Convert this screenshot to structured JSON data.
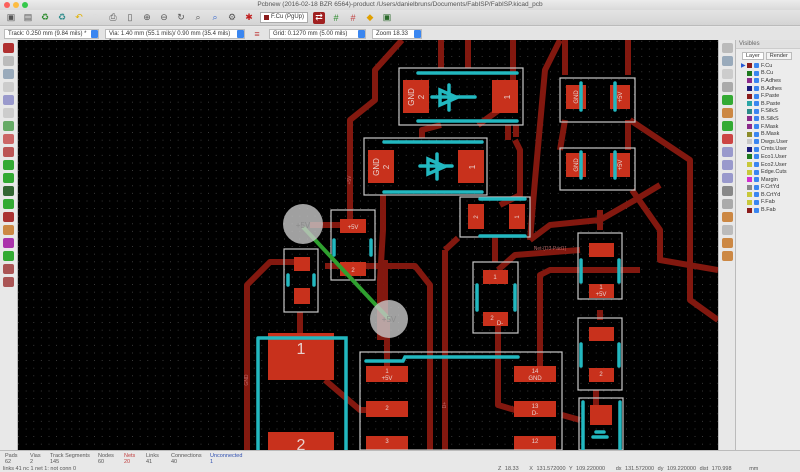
{
  "window": {
    "title": "Pcbnew (2016-02-18 BZR 6564)-product /Users/danielbruns/Documents/FabISP/FabISP.kicad_pcb"
  },
  "toolbar": {
    "layer_select": "F.Cu (PgUp)"
  },
  "options": {
    "track": "Track: 0.250 mm (9.84 mils) *",
    "via": "Via: 1.40 mm (55.1 mils)/ 0.90 mm (35.4 mils) *",
    "grid": "Grid: 0.1270 mm (5.00 mils)",
    "zoom": "Zoom 18.33"
  },
  "layers_panel": {
    "title": "Visibles",
    "tabs": [
      "Layer",
      "Render"
    ],
    "layers": [
      {
        "name": "F.Cu",
        "color": "#8b1c1c"
      },
      {
        "name": "B.Cu",
        "color": "#1f7a1f"
      },
      {
        "name": "F.Adhes",
        "color": "#8b2a8b"
      },
      {
        "name": "B.Adhes",
        "color": "#1a1a7a"
      },
      {
        "name": "F.Paste",
        "color": "#8b1c1c"
      },
      {
        "name": "B.Paste",
        "color": "#2aa5a5"
      },
      {
        "name": "F.SilkS",
        "color": "#2a8a8a"
      },
      {
        "name": "B.SilkS",
        "color": "#8b2a8b"
      },
      {
        "name": "F.Mask",
        "color": "#8b2a8b"
      },
      {
        "name": "B.Mask",
        "color": "#8b8b2a"
      },
      {
        "name": "Dwgs.User",
        "color": "#c8c8c8"
      },
      {
        "name": "Cmts.User",
        "color": "#1a1a7a"
      },
      {
        "name": "Eco1.User",
        "color": "#1f7a1f"
      },
      {
        "name": "Eco2.User",
        "color": "#c8c83a"
      },
      {
        "name": "Edge.Cuts",
        "color": "#c8c83a"
      },
      {
        "name": "Margin",
        "color": "#d030d0"
      },
      {
        "name": "F.CrtYd",
        "color": "#888888"
      },
      {
        "name": "B.CrtYd",
        "color": "#c8c83a"
      },
      {
        "name": "F.Fab",
        "color": "#c8c83a"
      },
      {
        "name": "B.Fab",
        "color": "#8b1c1c"
      }
    ]
  },
  "pcb": {
    "d1": {
      "pad2_net": "GND",
      "pad2": "2",
      "pad1": "1"
    },
    "d2": {
      "pad2_net": "GND",
      "pad2": "2",
      "pad1": "1"
    },
    "r_top1": {
      "a": "GND",
      "b": "+5V"
    },
    "r_top2": {
      "a": "GND",
      "b": "+5V"
    },
    "via_a": "+5V",
    "via_b": "+5V",
    "small1": {
      "a": "+5V",
      "b": "2"
    },
    "j1": {
      "pad1": "1",
      "pad2": "2"
    },
    "ic": {
      "p1": "1",
      "p1n": "+5V",
      "p2": "2",
      "p3": "3",
      "p14": "14",
      "p14n": "GND",
      "p13": "13",
      "p13n": "D-",
      "p12": "12"
    },
    "r_mid": {
      "a": "1",
      "b": "2",
      "bn": "D-"
    },
    "r_d3": {
      "a": "2",
      "b": "1"
    },
    "r_right": {
      "a": "1",
      "an": "+5V",
      "b": "2"
    },
    "nets": {
      "gnd": "GND",
      "p5v": "+5V",
      "dplus": "D+",
      "net_d3": "Net-(D3-Pad1)"
    }
  },
  "stats": {
    "headers": [
      "Pads",
      "Vias",
      "Track Segments",
      "Nodes",
      "Nets",
      "Links",
      "Connections",
      "Unconnected"
    ],
    "values": [
      "62",
      "2",
      "145",
      "60",
      "20",
      "41",
      "40",
      "1"
    ],
    "message": "links 41 nc 1  net 1: not conn 0"
  },
  "coords": {
    "z": "Z 18.33",
    "x": "X 131.572000",
    "y": "Y 109.220000",
    "dx": "dx 131.572000",
    "dy": "dy 109.220000",
    "dist": "dist 170.998",
    "units": "mm"
  }
}
